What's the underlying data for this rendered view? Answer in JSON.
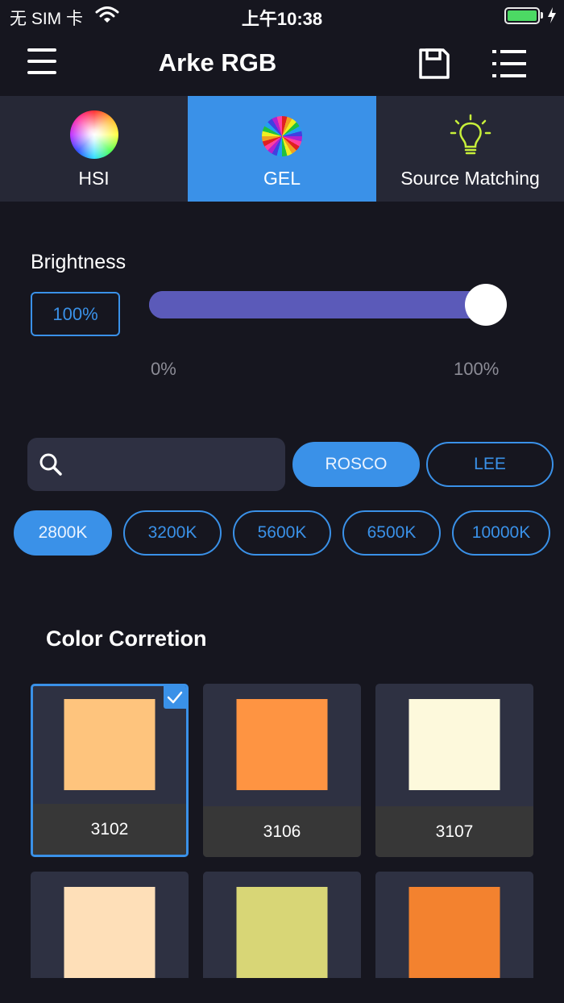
{
  "status_bar": {
    "carrier": "无 SIM 卡",
    "time": "上午10:38",
    "battery_level": 1.0,
    "battery_color": "#4cd964"
  },
  "nav": {
    "title": "Arke RGB",
    "icons": [
      "menu-icon",
      "save-icon",
      "list-icon"
    ]
  },
  "tabs": [
    {
      "label": "HSI",
      "icon": "color-wheel-icon",
      "active": false
    },
    {
      "label": "GEL",
      "icon": "gel-wheel-icon",
      "active": true
    },
    {
      "label": "Source Matching",
      "icon": "bulb-icon",
      "active": false
    }
  ],
  "brightness": {
    "label": "Brightness",
    "value_text": "100%",
    "level": 1.0,
    "min_label": "0%",
    "max_label": "100%"
  },
  "search": {
    "placeholder": "",
    "value": ""
  },
  "brands": [
    {
      "label": "ROSCO",
      "active": true
    },
    {
      "label": "LEE",
      "active": false
    }
  ],
  "temperatures": [
    {
      "label": "2800K",
      "active": true
    },
    {
      "label": "3200K",
      "active": false
    },
    {
      "label": "5600K",
      "active": false
    },
    {
      "label": "6500K",
      "active": false
    },
    {
      "label": "10000K",
      "active": false
    }
  ],
  "section": {
    "title": "Color Corretion"
  },
  "gels": [
    {
      "code": "3102",
      "color": "#fec47d",
      "selected": true
    },
    {
      "code": "3106",
      "color": "#fe9442",
      "selected": false
    },
    {
      "code": "3107",
      "color": "#fdf9dc",
      "selected": false
    },
    {
      "code": "",
      "color": "#fedfb8",
      "selected": false
    },
    {
      "code": "",
      "color": "#d8d676",
      "selected": false
    },
    {
      "code": "",
      "color": "#f3822f",
      "selected": false
    }
  ],
  "colors": {
    "accent": "#3a91e8",
    "slider": "#5b5ab9",
    "background": "#16161f",
    "card": "#2e3142"
  }
}
